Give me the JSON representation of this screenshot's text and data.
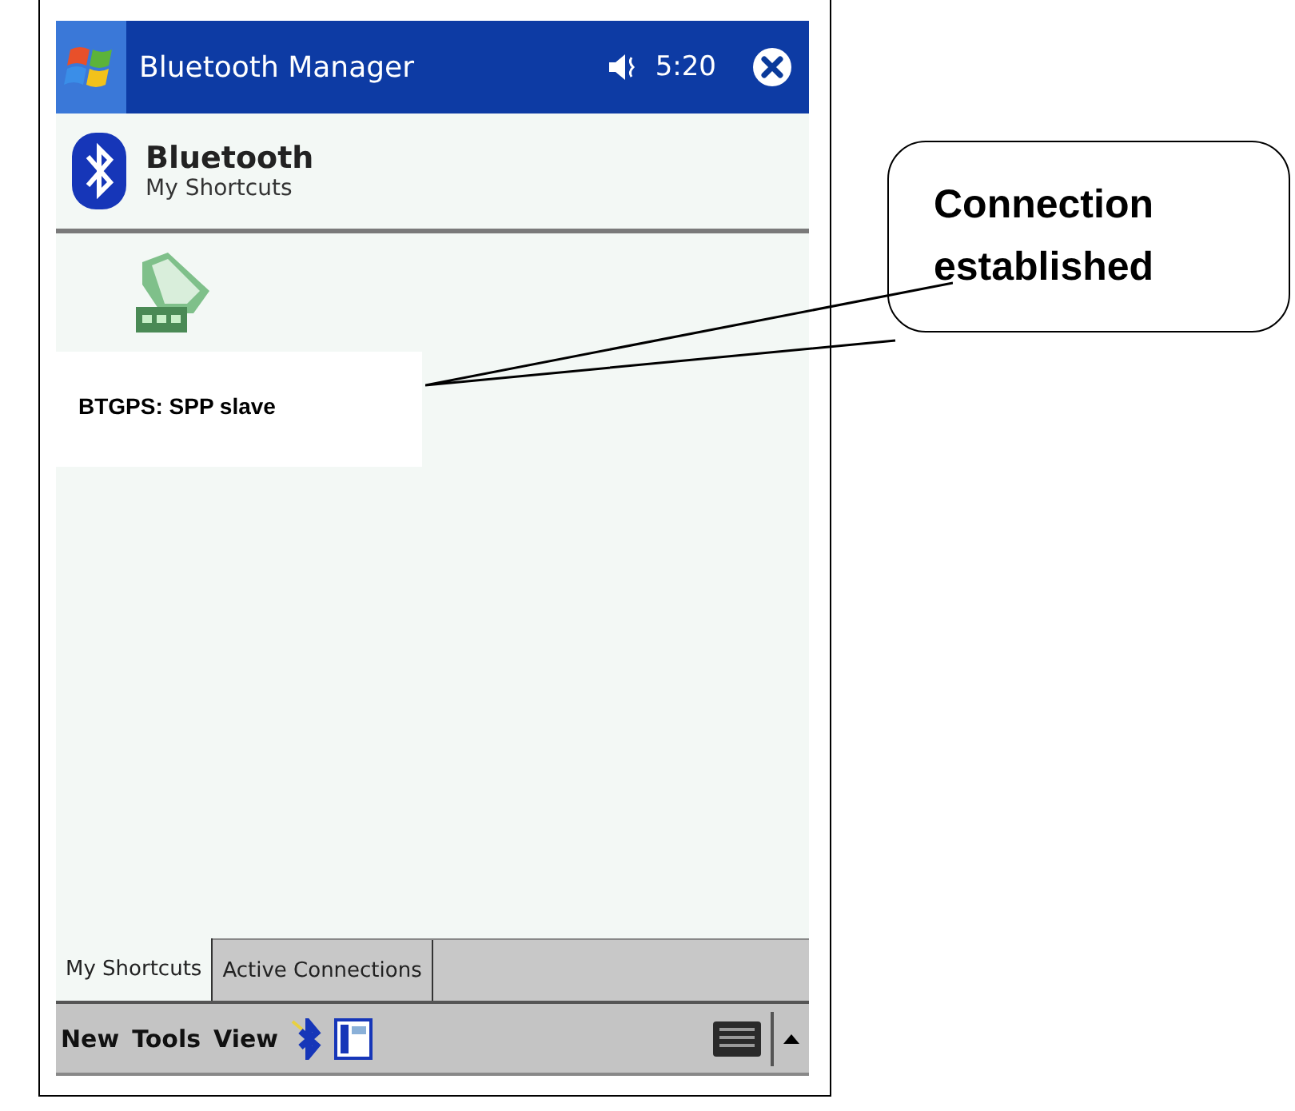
{
  "window": {
    "title": "Bluetooth Manager",
    "time": "5:20"
  },
  "header": {
    "title": "Bluetooth",
    "subtitle": "My Shortcuts"
  },
  "shortcuts": [
    {
      "label": "BTGPS: SPP slave"
    }
  ],
  "tabs": [
    {
      "label": "My Shortcuts",
      "selected": true
    },
    {
      "label": "Active Connections",
      "selected": false
    }
  ],
  "menu": [
    "New",
    "Tools",
    "View"
  ],
  "callout": {
    "text": "Connection established"
  }
}
